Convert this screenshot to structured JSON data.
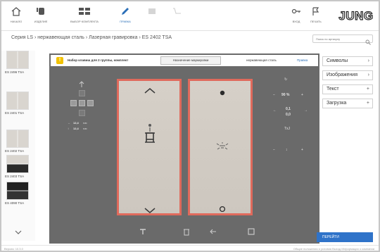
{
  "toolbar": {
    "items": [
      {
        "label": "НАЧАЛО"
      },
      {
        "label": "ИЗДЕЛИЕ"
      },
      {
        "label": "ВЫБОР КОМПЛЕКТА"
      },
      {
        "label": "ПРАВКА"
      },
      {
        "label": ""
      },
      {
        "label": ""
      },
      {
        "label": "ВХОД"
      },
      {
        "label": "ПЕЧАТЬ"
      }
    ],
    "brand": "JUNG"
  },
  "breadcrumb": "Серия LS › нержавеющая сталь › Лазерная гравировка › ES 2402 TSA",
  "search": {
    "placeholder": "Поиск по артикулу"
  },
  "thumbnails": [
    {
      "caption": "ES 2496 TSA"
    },
    {
      "caption": "ES 2401 TSA"
    },
    {
      "caption": "ES 2402 TSA"
    },
    {
      "caption": "ES 2403 TSA"
    },
    {
      "caption": "ES 4090 TSA"
    }
  ],
  "notice": {
    "text": "Набор клавиш для 2 группы, комплект",
    "button": "Назначение маркировки",
    "material": "нержавеющая сталь",
    "link": "Правка"
  },
  "controls": {
    "size_w": "12,4",
    "size_h": "12,4",
    "units": "мм",
    "zoom": "90 %",
    "pos_x": "0,1",
    "pos_y": "0,0",
    "font": "TxJ"
  },
  "right_panel": [
    {
      "label": "Символы",
      "mark": "›"
    },
    {
      "label": "Изображения",
      "mark": "›"
    },
    {
      "label": "Текст",
      "mark": "+"
    },
    {
      "label": "Загрузка",
      "mark": "+"
    }
  ],
  "proceed_label": "ПЕРЕЙТИ",
  "footer": {
    "version": "Версия: 10.3.0",
    "links": "Общие положения и условия    Выход    Информация о компании"
  },
  "colors": {
    "accent": "#2f73c9",
    "plate_border": "#e06a5c",
    "editor_bg": "#6a6a6a"
  }
}
